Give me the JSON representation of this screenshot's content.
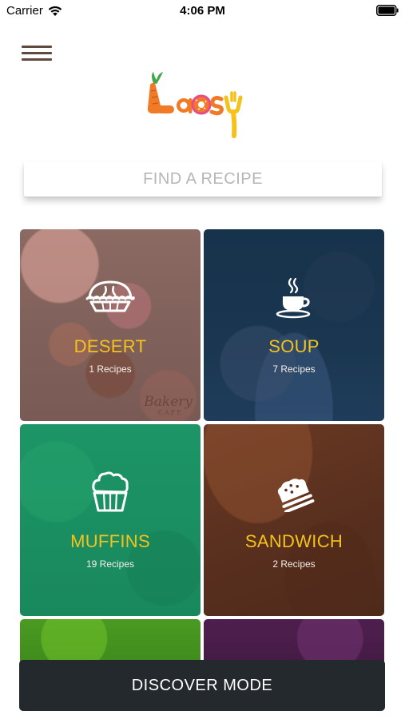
{
  "status_bar": {
    "carrier": "Carrier",
    "time": "4:06 PM"
  },
  "header": {
    "logo_text": "Laosy"
  },
  "search": {
    "placeholder": "FIND A RECIPE",
    "value": ""
  },
  "categories": [
    {
      "title": "DESERT",
      "count_label": "1 Recipes",
      "icon": "pie-icon",
      "background_text": "Bakery",
      "background_subtext": "CAFE"
    },
    {
      "title": "SOUP",
      "count_label": "7 Recipes",
      "icon": "soup-bowl-icon"
    },
    {
      "title": "MUFFINS",
      "count_label": "19 Recipes",
      "icon": "muffin-icon"
    },
    {
      "title": "SANDWICH",
      "count_label": "2 Recipes",
      "icon": "sandwich-icon"
    }
  ],
  "footer": {
    "discover_label": "DISCOVER MODE"
  },
  "colors": {
    "accent_yellow": "#f5c21b",
    "discover_bg": "#24292e",
    "menu_lines": "#5e4a3e"
  }
}
